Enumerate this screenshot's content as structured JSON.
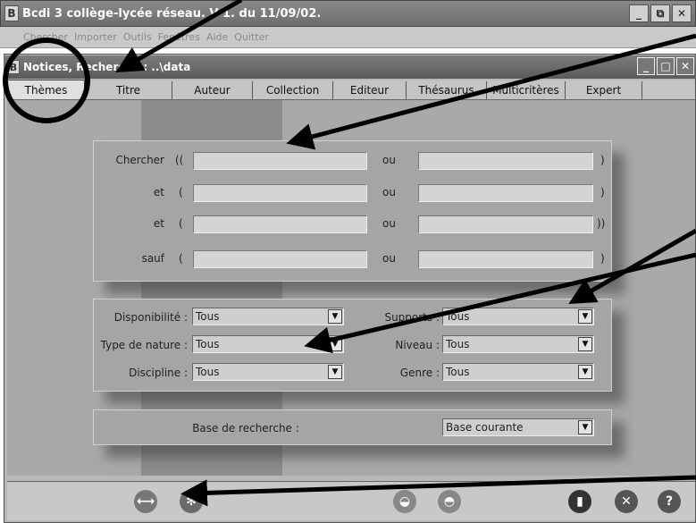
{
  "outer_window": {
    "title": "Bcdi 3 collège-lycée réseau. V 1.  du 11/09/02.",
    "app_icon": "B",
    "controls": [
      "_",
      "⧉",
      "✕"
    ]
  },
  "menu": {
    "items": [
      "Chercher",
      "Importer",
      "Outils",
      "Fenêtres",
      "Aide",
      "Quitter"
    ]
  },
  "inner_window": {
    "title": "Notices, Recherche : ..\\data",
    "app_icon": "B",
    "controls": [
      "_",
      "□",
      "✕"
    ]
  },
  "tabs": [
    "Thèmes",
    "Titre",
    "Auteur",
    "Collection",
    "Editeur",
    "Thésaurus",
    "Multicritères",
    "Expert"
  ],
  "search": {
    "rows": [
      {
        "label": "Chercher",
        "open": "((",
        "mid": "ou",
        "close": ")"
      },
      {
        "label": "et",
        "open": "(",
        "mid": "ou",
        "close": ")"
      },
      {
        "label": "et",
        "open": "(",
        "mid": "ou",
        "close": "))"
      },
      {
        "label": "sauf",
        "open": "(",
        "mid": "ou",
        "close": ")"
      }
    ]
  },
  "filters": {
    "disponibilite": {
      "label": "Disponibilité :",
      "value": "Tous"
    },
    "supports": {
      "label": "Supports :",
      "value": "Tous"
    },
    "type_nature": {
      "label": "Type de nature :",
      "value": "Tous"
    },
    "niveau": {
      "label": "Niveau :",
      "value": "Tous"
    },
    "discipline": {
      "label": "Discipline :",
      "value": "Tous"
    },
    "genre": {
      "label": "Genre :",
      "value": "Tous"
    }
  },
  "base": {
    "label": "Base de recherche :",
    "value": "Base courante"
  },
  "toolbar": {
    "icons": [
      "link-icon",
      "gear-icon",
      "basket-icon",
      "basket-alt-icon",
      "book-icon",
      "close-icon",
      "help-icon"
    ]
  },
  "colors": {
    "annotation": "#000000",
    "panel": "#a5a5a5"
  }
}
